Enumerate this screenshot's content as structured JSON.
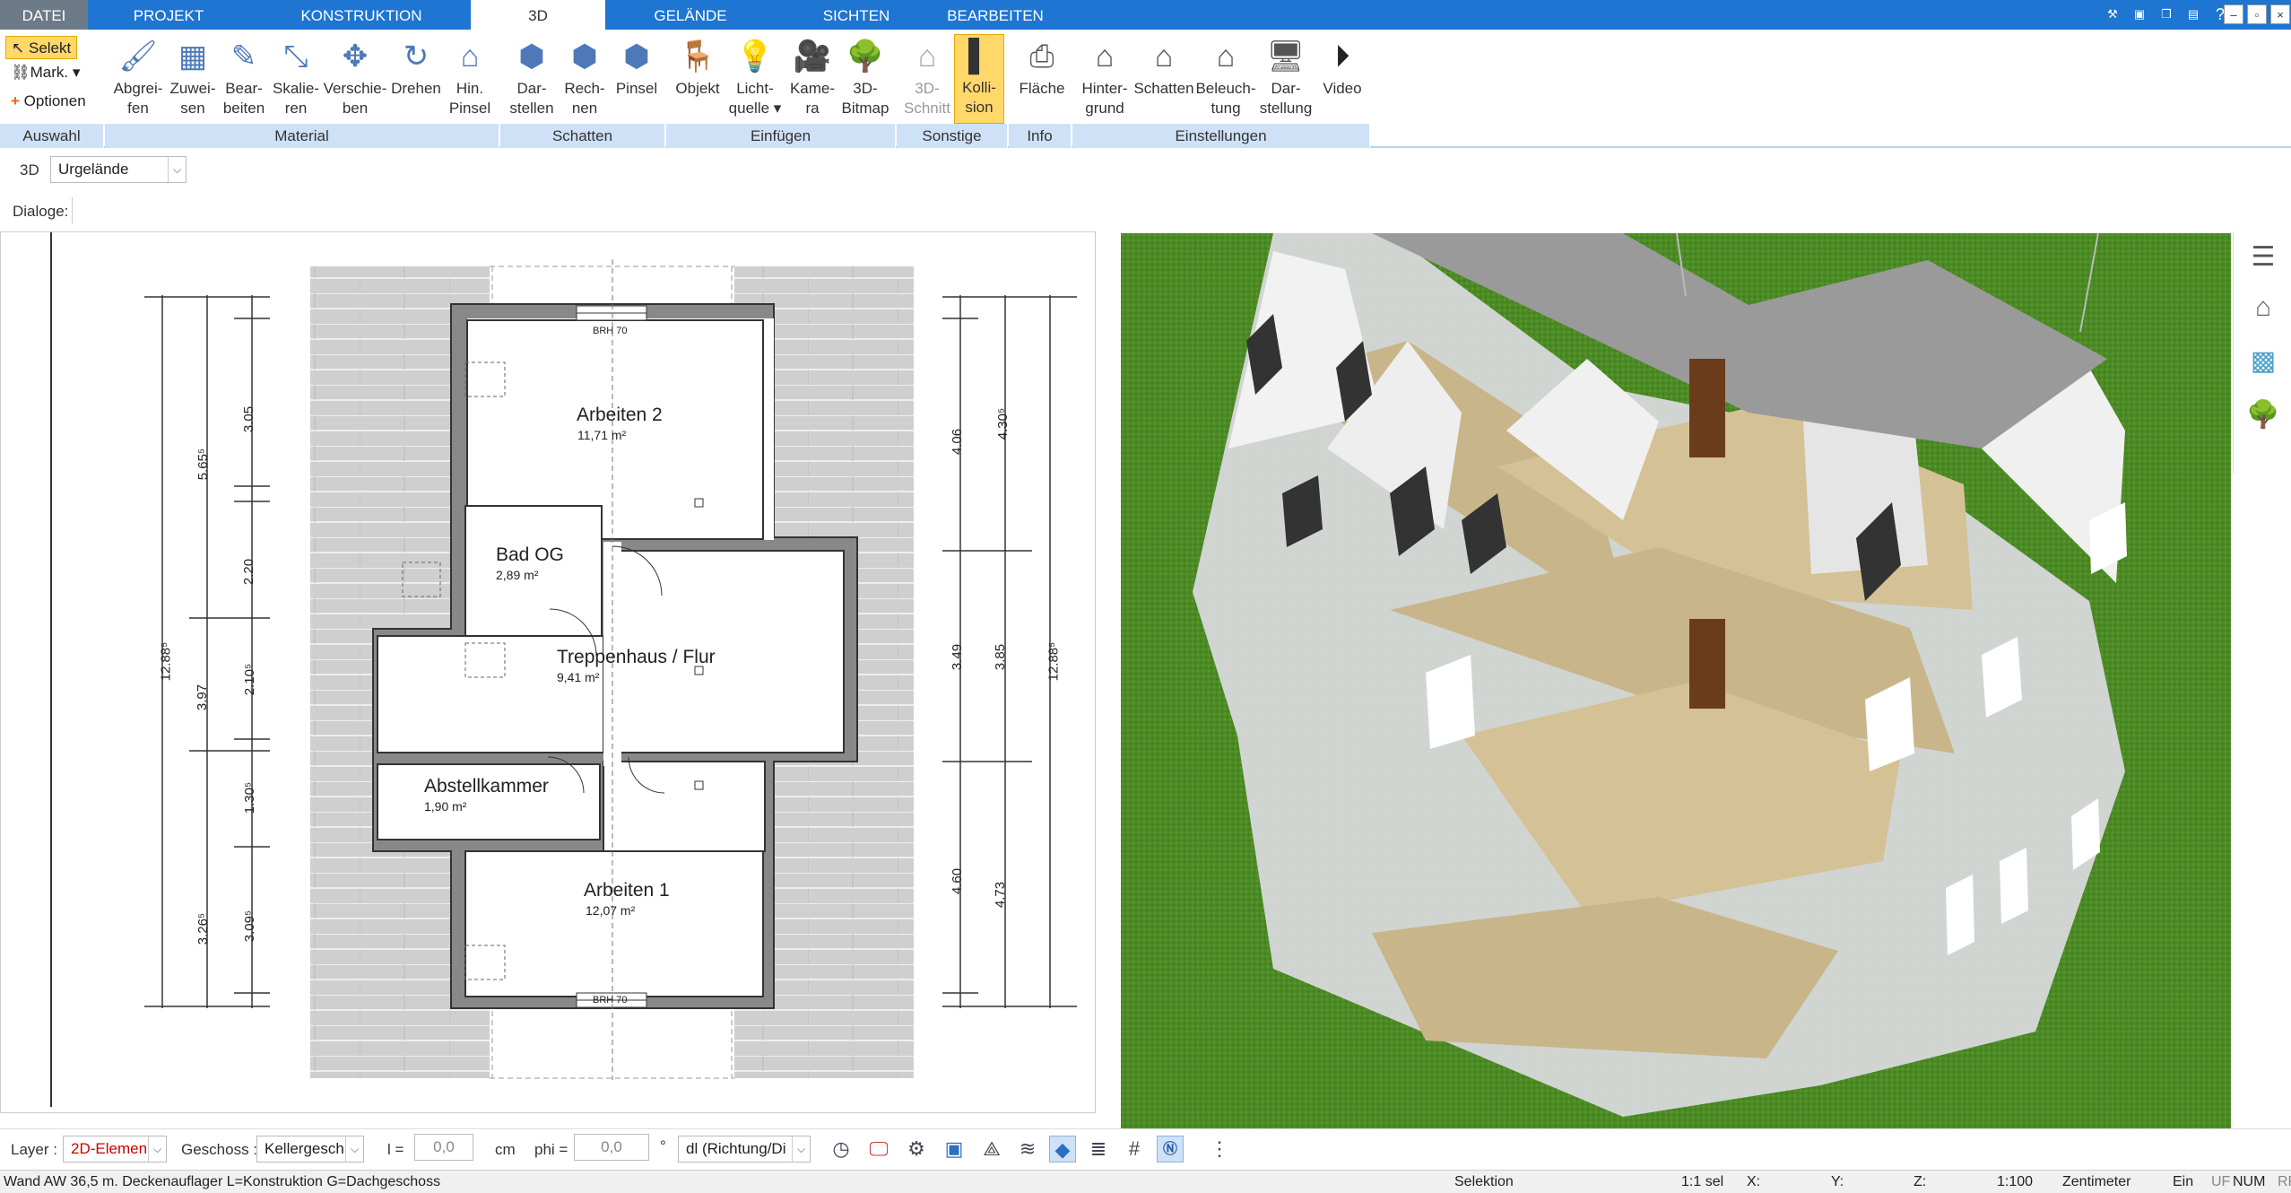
{
  "menu": {
    "tabs": [
      "DATEI",
      "PROJEKT",
      "KONSTRUKTION",
      "3D",
      "GELÄNDE",
      "SICHTEN",
      "BEARBEITEN"
    ]
  },
  "ribbon": {
    "auswahl": {
      "selekt": "Selekt",
      "mark": "Mark.",
      "optionen": "Optionen"
    },
    "material": [
      "Abgrei-\nfen",
      "Zuwei-\nsen",
      "Bear-\nbeiten",
      "Skalie-\nren",
      "Verschie-\nben",
      "Drehen",
      "Hin.\nPinsel"
    ],
    "schatten": [
      "Dar-\nstellen",
      "Rech-\nnen",
      "Pinsel"
    ],
    "einfuegen": [
      "Objekt",
      "Licht-\nquelle ▾",
      "Kame-\nra",
      "3D-\nBitmap"
    ],
    "sonstige": [
      "3D-\nSchnitt",
      "Kolli-\nsion"
    ],
    "info": [
      "Fläche"
    ],
    "einstellungen": [
      "Hinter-\ngrund",
      "Schatten",
      "Beleuch-\ntung",
      "Dar-\nstellung",
      "Video"
    ],
    "groups": [
      "Auswahl",
      "Material",
      "Schatten",
      "Einfügen",
      "Sonstige",
      "Info",
      "Einstellungen"
    ]
  },
  "toolbar": {
    "mode": "3D",
    "terrain": "Urgelände",
    "dialoge": "Dialoge:"
  },
  "plan": {
    "rooms": [
      {
        "name": "Arbeiten 2",
        "area": "11,71 m²"
      },
      {
        "name": "Bad OG",
        "area": "2,89 m²"
      },
      {
        "name": "Treppenhaus / Flur",
        "area": "9,41 m²"
      },
      {
        "name": "Abstellkammer",
        "area": "1,90 m²"
      },
      {
        "name": "Arbeiten 1",
        "area": "12,07 m²"
      }
    ],
    "window_label": "BRH 70",
    "dims": [
      "12.88⁵",
      "5.65⁵",
      "3.97",
      "3.26⁵",
      "3.05",
      "2.20",
      "2.10⁵",
      "1.30⁵",
      "3.09⁵",
      "4.06",
      "3.49",
      "4.60",
      "4.30⁵",
      "3.85",
      "4.73"
    ]
  },
  "bottom": {
    "layer_label": "Layer :",
    "layer_value": "2D-Elemen",
    "geschoss_label": "Geschoss :",
    "geschoss_value": "Kellergesch",
    "length_label": "l =",
    "length_value": "0,0",
    "length_unit": "cm",
    "phi_label": "phi =",
    "phi_value": "0,0",
    "phi_unit": "°",
    "direction_value": "dl (Richtung/Di"
  },
  "status": {
    "message": "Wand AW 36,5 m. Deckenauflager L=Konstruktion G=Dachgeschoss",
    "mode": "Selektion",
    "scale_sel": "1:1 sel",
    "x": "X:",
    "y": "Y:",
    "z": "Z:",
    "scale": "1:100",
    "unit": "Zentimeter",
    "ein": "Ein",
    "uf": "UF",
    "num": "NUM",
    "rf": "RF"
  }
}
